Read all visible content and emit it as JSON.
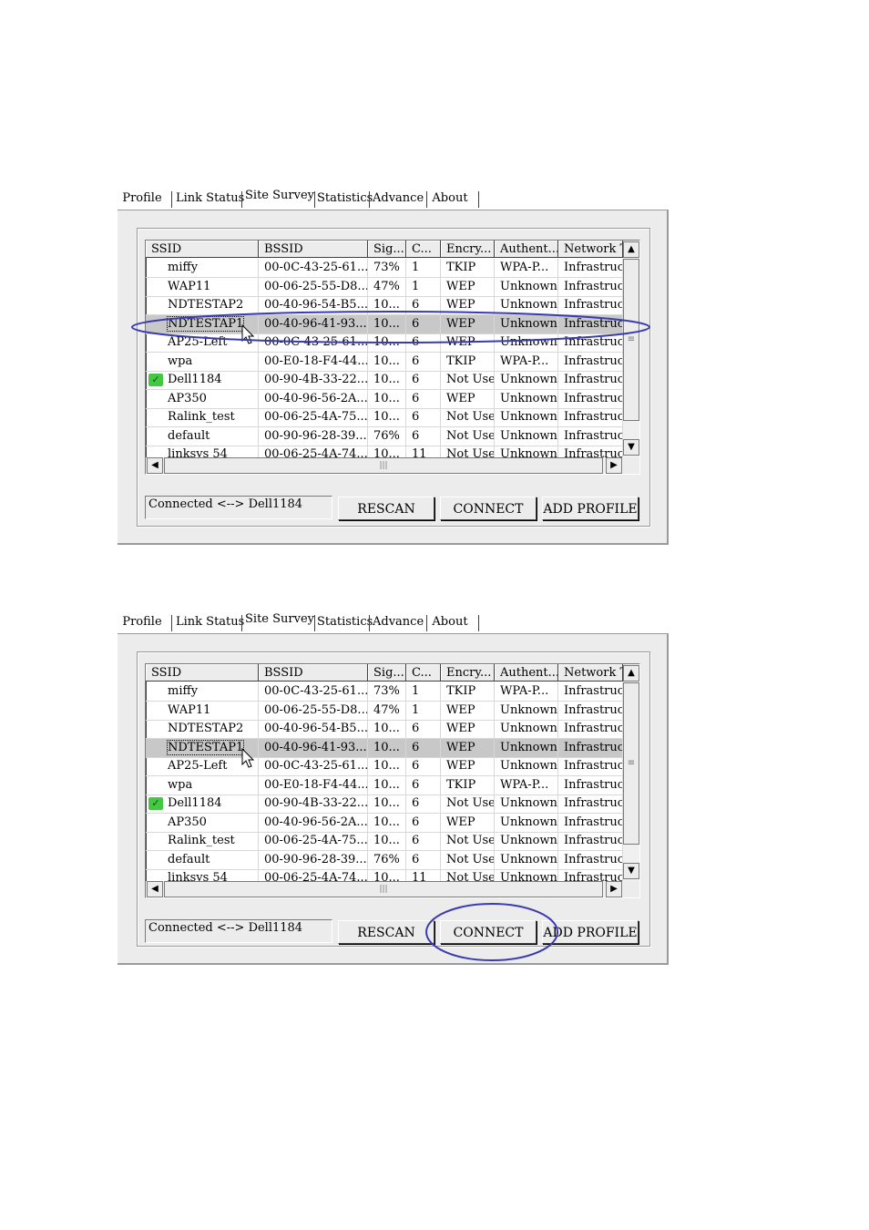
{
  "tabs": [
    {
      "label": "Profile",
      "active": false
    },
    {
      "label": "Link Status",
      "active": false
    },
    {
      "label": "Site Survey",
      "active": true
    },
    {
      "label": "Statistics",
      "active": false
    },
    {
      "label": "Advance",
      "active": false
    },
    {
      "label": "About",
      "active": false
    }
  ],
  "columns": [
    "SSID",
    "BSSID",
    "Sig...",
    "C...",
    "Encry...",
    "Authent...",
    "Network T"
  ],
  "screen1": {
    "rows": [
      {
        "ssid": "miffy",
        "bssid": "00-0C-43-25-61...",
        "signal": "73%",
        "channel": "1",
        "encryption": "TKIP",
        "auth": "WPA-P...",
        "network": "Infrastruct."
      },
      {
        "ssid": "WAP11",
        "bssid": "00-06-25-55-D8...",
        "signal": "47%",
        "channel": "1",
        "encryption": "WEP",
        "auth": "Unknown",
        "network": "Infrastruct."
      },
      {
        "ssid": "NDTESTAP2",
        "bssid": "00-40-96-54-B5...",
        "signal": "10...",
        "channel": "6",
        "encryption": "WEP",
        "auth": "Unknown",
        "network": "Infrastruct."
      },
      {
        "ssid": "NDTESTAP1",
        "bssid": "00-40-96-41-93...",
        "signal": "10...",
        "channel": "6",
        "encryption": "WEP",
        "auth": "Unknown",
        "network": "Infrastruct."
      },
      {
        "ssid": "AP25-Left",
        "bssid": "00-0C-43-25-61...",
        "signal": "10...",
        "channel": "6",
        "encryption": "WEP",
        "auth": "Unknown",
        "network": "Infrastruct."
      },
      {
        "ssid": "wpa",
        "bssid": "00-E0-18-F4-44...",
        "signal": "10...",
        "channel": "6",
        "encryption": "TKIP",
        "auth": "WPA-P...",
        "network": "Infrastruct."
      },
      {
        "ssid": "Dell1184",
        "bssid": "00-90-4B-33-22...",
        "signal": "10...",
        "channel": "6",
        "encryption": "Not Use",
        "auth": "Unknown",
        "network": "Infrastruct."
      },
      {
        "ssid": "AP350",
        "bssid": "00-40-96-56-2A...",
        "signal": "10...",
        "channel": "6",
        "encryption": "WEP",
        "auth": "Unknown",
        "network": "Infrastruct."
      },
      {
        "ssid": "Ralink_test",
        "bssid": "00-06-25-4A-75...",
        "signal": "10...",
        "channel": "6",
        "encryption": "Not Use",
        "auth": "Unknown",
        "network": "Infrastruct."
      },
      {
        "ssid": "default",
        "bssid": "00-90-96-28-39...",
        "signal": "76%",
        "channel": "6",
        "encryption": "Not Use",
        "auth": "Unknown",
        "network": "Infrastruct."
      },
      {
        "ssid": "linksys 54",
        "bssid": "00-06-25-4A-74...",
        "signal": "10...",
        "channel": "11",
        "encryption": "Not Use",
        "auth": "Unknown",
        "network": "Infrastruct."
      }
    ],
    "status": "Connected <--> Dell1184",
    "buttons": {
      "rescan": "RESCAN",
      "connect": "CONNECT",
      "add_profile": "ADD PROFILE"
    }
  },
  "screen2": {
    "rows": [
      {
        "ssid": "miffy",
        "bssid": "00-0C-43-25-61...",
        "signal": "73%",
        "channel": "1",
        "encryption": "TKIP",
        "auth": "WPA-P...",
        "network": "Infrastruct."
      },
      {
        "ssid": "WAP11",
        "bssid": "00-06-25-55-D8...",
        "signal": "47%",
        "channel": "1",
        "encryption": "WEP",
        "auth": "Unknown",
        "network": "Infrastruct."
      },
      {
        "ssid": "NDTESTAP2",
        "bssid": "00-40-96-54-B5...",
        "signal": "10...",
        "channel": "6",
        "encryption": "WEP",
        "auth": "Unknown",
        "network": "Infrastruct."
      },
      {
        "ssid": "NDTESTAP1",
        "bssid": "00-40-96-41-93...",
        "signal": "10...",
        "channel": "6",
        "encryption": "WEP",
        "auth": "Unknown",
        "network": "Infrastruct."
      },
      {
        "ssid": "AP25-Left",
        "bssid": "00-0C-43-25-61...",
        "signal": "10...",
        "channel": "6",
        "encryption": "WEP",
        "auth": "Unknown",
        "network": "Infrastruct."
      },
      {
        "ssid": "wpa",
        "bssid": "00-E0-18-F4-44...",
        "signal": "10...",
        "channel": "6",
        "encryption": "TKIP",
        "auth": "WPA-P...",
        "network": "Infrastruct."
      },
      {
        "ssid": "Dell1184",
        "bssid": "00-90-4B-33-22...",
        "signal": "10...",
        "channel": "6",
        "encryption": "Not Use",
        "auth": "Unknown",
        "network": "Infrastruct."
      },
      {
        "ssid": "AP350",
        "bssid": "00-40-96-56-2A...",
        "signal": "10...",
        "channel": "6",
        "encryption": "WEP",
        "auth": "Unknown",
        "network": "Infrastruct."
      },
      {
        "ssid": "Ralink_test",
        "bssid": "00-06-25-4A-75...",
        "signal": "10...",
        "channel": "6",
        "encryption": "Not Use",
        "auth": "Unknown",
        "network": "Infrastruct."
      },
      {
        "ssid": "default",
        "bssid": "00-90-96-28-39...",
        "signal": "76%",
        "channel": "6",
        "encryption": "Not Use",
        "auth": "Unknown",
        "network": "Infrastruct."
      },
      {
        "ssid": "linksys 54",
        "bssid": "00-06-25-4A-74...",
        "signal": "10...",
        "channel": "11",
        "encryption": "Not Use",
        "auth": "Unknown",
        "network": "Infrastruct."
      }
    ],
    "status": "Connected <--> Dell1184",
    "buttons": {
      "rescan": "RESCAN",
      "connect": "CONNECT",
      "add_profile": "ADD PROFILE"
    }
  },
  "selected_ssid": "NDTESTAP1",
  "connected_ssid": "Dell1184",
  "icons": {
    "connected": "connected-network-icon",
    "cursor": "mouse-pointer-icon",
    "scroll_up": "scroll-up-arrow-icon",
    "scroll_down": "scroll-down-arrow-icon",
    "scroll_left": "scroll-left-arrow-icon",
    "scroll_right": "scroll-right-arrow-icon"
  },
  "colors": {
    "highlight_ellipse": "#3b3bb0",
    "selected_row": "#c8c8c8",
    "panel": "#ececec",
    "connected_icon": "#44c844"
  }
}
